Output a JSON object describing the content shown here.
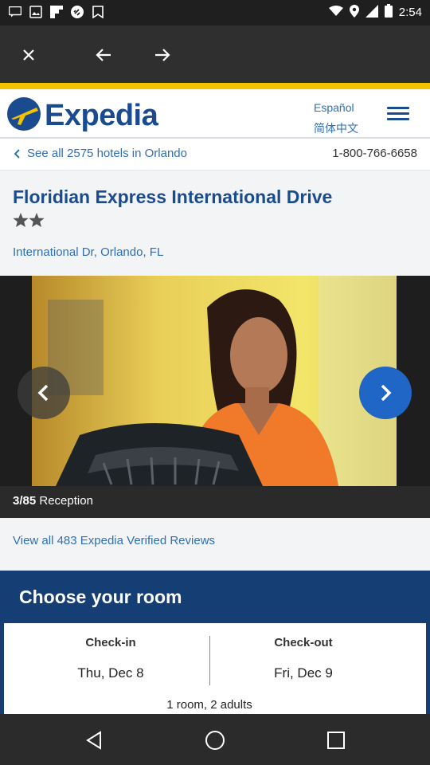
{
  "status_bar": {
    "time": "2:54",
    "icons": [
      "message-icon",
      "photo-icon",
      "flipboard-icon",
      "link-icon",
      "bookmark-icon",
      "wifi-icon",
      "location-icon",
      "cellular-icon",
      "battery-icon"
    ]
  },
  "browser_toolbar": {
    "icons": [
      "close-icon",
      "back-arrow-icon",
      "forward-arrow-icon"
    ]
  },
  "header": {
    "logo_text": "Expedia",
    "lang_es": "Español",
    "lang_zh": "简体中文"
  },
  "breadcrumb": {
    "text": "See all 2575 hotels in Orlando",
    "phone": "1-800-766-6658"
  },
  "hotel": {
    "name": "Floridian Express International Drive",
    "star_rating": 2.5,
    "address_street": "International Dr,",
    "address_city": "Orlando,",
    "address_state": "FL"
  },
  "gallery": {
    "counter": "3/85",
    "caption": "Reception"
  },
  "reviews": {
    "link_text": "View all 483 Expedia Verified Reviews"
  },
  "room": {
    "title": "Choose your room",
    "checkin_label": "Check-in",
    "checkin_value": "Thu, Dec 8",
    "checkout_label": "Check-out",
    "checkout_value": "Fri, Dec 9",
    "guests": "1 room, 2 adults"
  },
  "colors": {
    "brand_blue": "#1b4b8f",
    "link_blue": "#2f6fb5",
    "accent_yellow": "#f5c200",
    "room_band": "#153f74",
    "next_button": "#1f66c6"
  }
}
